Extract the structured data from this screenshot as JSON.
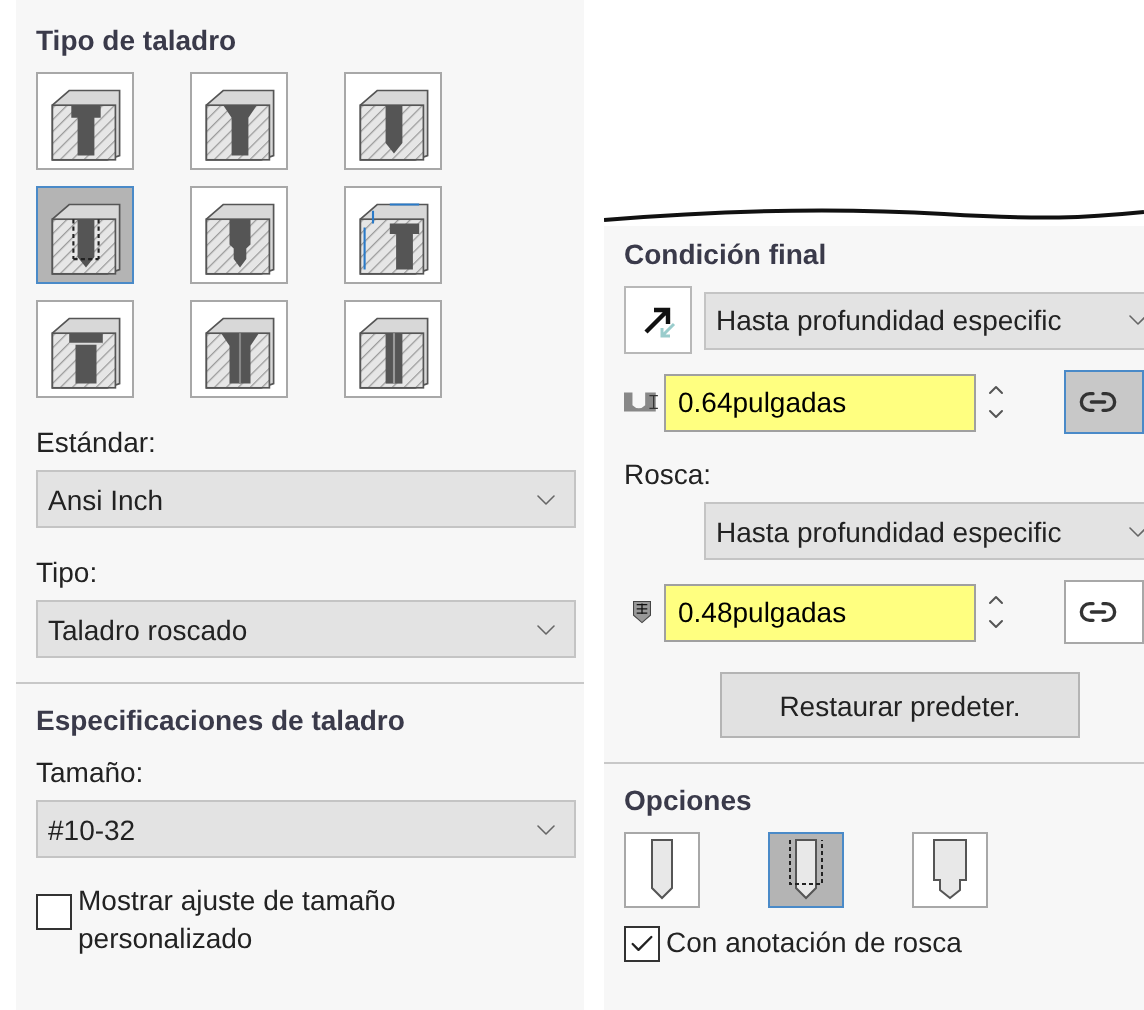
{
  "hole_type": {
    "title": "Tipo de taladro",
    "options": [
      {
        "kind": "counterbore",
        "selected": false
      },
      {
        "kind": "countersink",
        "selected": false
      },
      {
        "kind": "hole",
        "selected": false
      },
      {
        "kind": "tap",
        "selected": true
      },
      {
        "kind": "pipe_tap",
        "selected": false
      },
      {
        "kind": "legacy",
        "selected": false
      },
      {
        "kind": "counterbore_slot",
        "selected": false
      },
      {
        "kind": "countersink_slot",
        "selected": false
      },
      {
        "kind": "slot",
        "selected": false
      }
    ]
  },
  "standard": {
    "label": "Estándar:",
    "value": "Ansi Inch"
  },
  "type": {
    "label": "Tipo:",
    "value": "Taladro roscado"
  },
  "hole_specs": {
    "title": "Especificaciones de taladro",
    "size_label": "Tamaño:",
    "size_value": "#10-32",
    "custom_size": {
      "label": "Mostrar ajuste de tamaño personalizado",
      "checked": false
    }
  },
  "end_condition": {
    "title": "Condición final",
    "condition": "Hasta profundidad especific",
    "depth": "0.64pulgadas",
    "depth_link_pressed": true,
    "thread_label": "Rosca:",
    "thread_condition": "Hasta profundidad especific",
    "thread_depth": "0.48pulgadas",
    "thread_link_pressed": false,
    "reset_button": "Restaurar predeter."
  },
  "options": {
    "title": "Opciones",
    "items": [
      {
        "kind": "tap_drill",
        "selected": false
      },
      {
        "kind": "cosmetic_thread",
        "selected": true
      },
      {
        "kind": "remove_thread",
        "selected": false
      }
    ],
    "thread_callout": {
      "label": "Con anotación de rosca",
      "checked": true
    }
  }
}
